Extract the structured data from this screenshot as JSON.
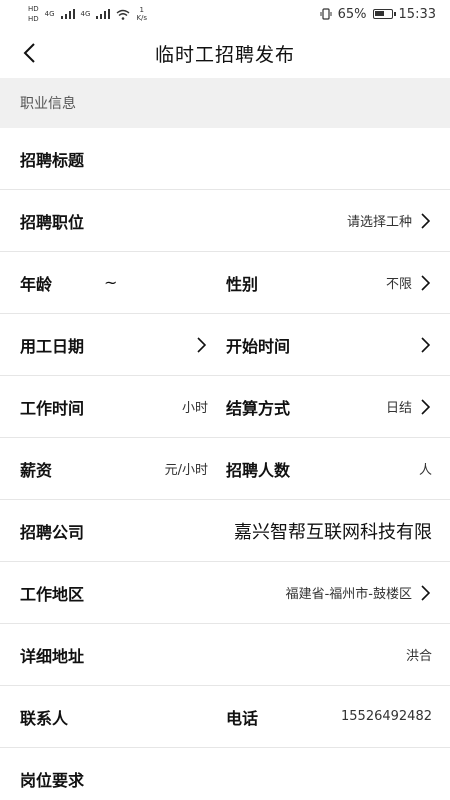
{
  "status_bar": {
    "sim_label_1": "HD",
    "net_1": "4G",
    "net_2": "4G",
    "sim_label_2": "HD",
    "speed_value": "1",
    "speed_unit": "K/s",
    "battery_pct": "65%",
    "battery_level": 0.65,
    "time": "15:33"
  },
  "nav": {
    "title": "临时工招聘发布"
  },
  "section": {
    "title": "职业信息"
  },
  "form": {
    "job_title_label": "招聘标题",
    "position_label": "招聘职位",
    "position_value": "请选择工种",
    "age_label": "年龄",
    "age_separator": "~",
    "gender_label": "性别",
    "gender_value": "不限",
    "work_date_label": "用工日期",
    "start_time_label": "开始时间",
    "work_hours_label": "工作时间",
    "work_hours_unit": "小时",
    "settlement_label": "结算方式",
    "settlement_value": "日结",
    "salary_label": "薪资",
    "salary_unit": "元/小时",
    "headcount_label": "招聘人数",
    "headcount_unit": "人",
    "company_label": "招聘公司",
    "company_value": "嘉兴智帮互联网科技有限",
    "region_label": "工作地区",
    "region_value": "福建省-福州市-鼓楼区",
    "address_label": "详细地址",
    "address_value": "洪合",
    "contact_label": "联系人",
    "phone_label": "电话",
    "phone_value": "15526492482",
    "requirements_label": "岗位要求"
  }
}
